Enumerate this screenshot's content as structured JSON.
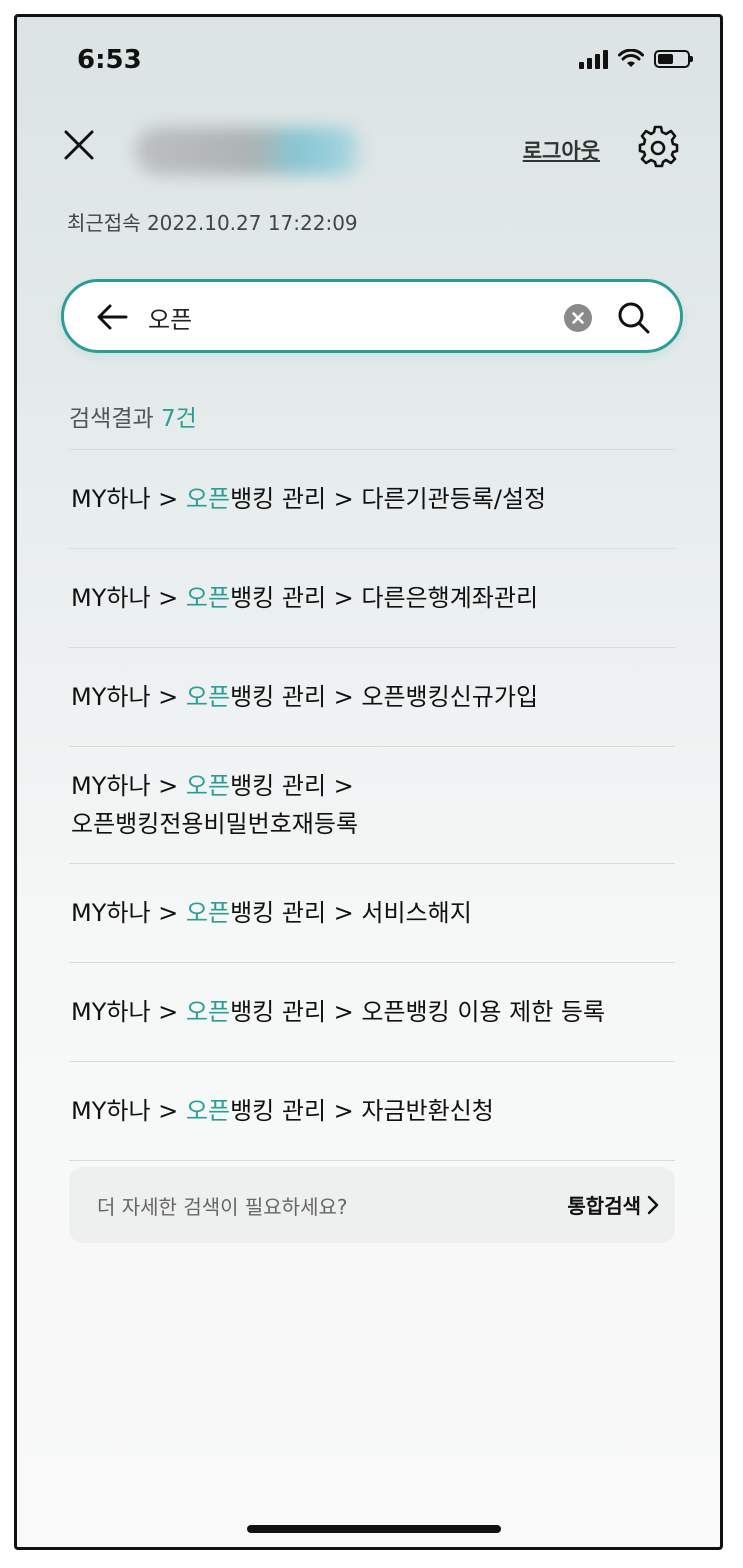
{
  "status": {
    "time": "6:53"
  },
  "header": {
    "logout_label": "로그아웃",
    "last_login": "최근접속 2022.10.27 17:22:09"
  },
  "search": {
    "value": "오픈",
    "placeholder": ""
  },
  "results": {
    "label": "검색결과",
    "count": "7건",
    "highlight": "오픈",
    "items": [
      {
        "prefix": "MY하나 > ",
        "hl": "오픈",
        "rest": "뱅킹 관리 > 다른기관등록/설정"
      },
      {
        "prefix": "MY하나 > ",
        "hl": "오픈",
        "rest": "뱅킹 관리 > 다른은행계좌관리"
      },
      {
        "prefix": "MY하나 > ",
        "hl": "오픈",
        "rest": "뱅킹 관리 > 오픈뱅킹신규가입"
      },
      {
        "prefix": "MY하나 > ",
        "hl": "오픈",
        "rest": "뱅킹 관리 >",
        "rest2": "오픈뱅킹전용비밀번호재등록"
      },
      {
        "prefix": "MY하나 > ",
        "hl": "오픈",
        "rest": "뱅킹 관리 > 서비스해지"
      },
      {
        "prefix": "MY하나 > ",
        "hl": "오픈",
        "rest": "뱅킹 관리 > 오픈뱅킹 이용 제한 등록"
      },
      {
        "prefix": "MY하나 > ",
        "hl": "오픈",
        "rest": "뱅킹 관리 > 자금반환신청"
      }
    ]
  },
  "more_search": {
    "prompt": "더 자세한 검색이 필요하세요?",
    "link_label": "통합검색"
  },
  "colors": {
    "accent": "#2a9d97",
    "text": "#111111"
  }
}
